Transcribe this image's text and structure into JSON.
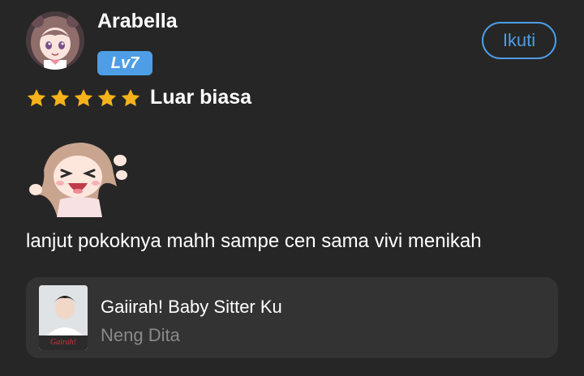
{
  "review": {
    "username": "Arabella",
    "level_badge": "Lv7",
    "follow_label": "Ikuti",
    "rating": {
      "stars": 5,
      "max": 5,
      "label": "Luar biasa"
    },
    "comment": "lanjut pokoknya mahh sampe cen sama vivi menikah"
  },
  "book": {
    "title": "Gaiirah! Baby Sitter Ku",
    "author": "Neng Dita",
    "cover_text": "Gairah!"
  },
  "colors": {
    "background": "#262626",
    "accent": "#4d9ee6",
    "star": "#f5b21b",
    "card": "#333333",
    "muted_text": "#8a8a8a"
  },
  "icons": {
    "star": "star-icon",
    "sticker": "sticker-icon"
  }
}
